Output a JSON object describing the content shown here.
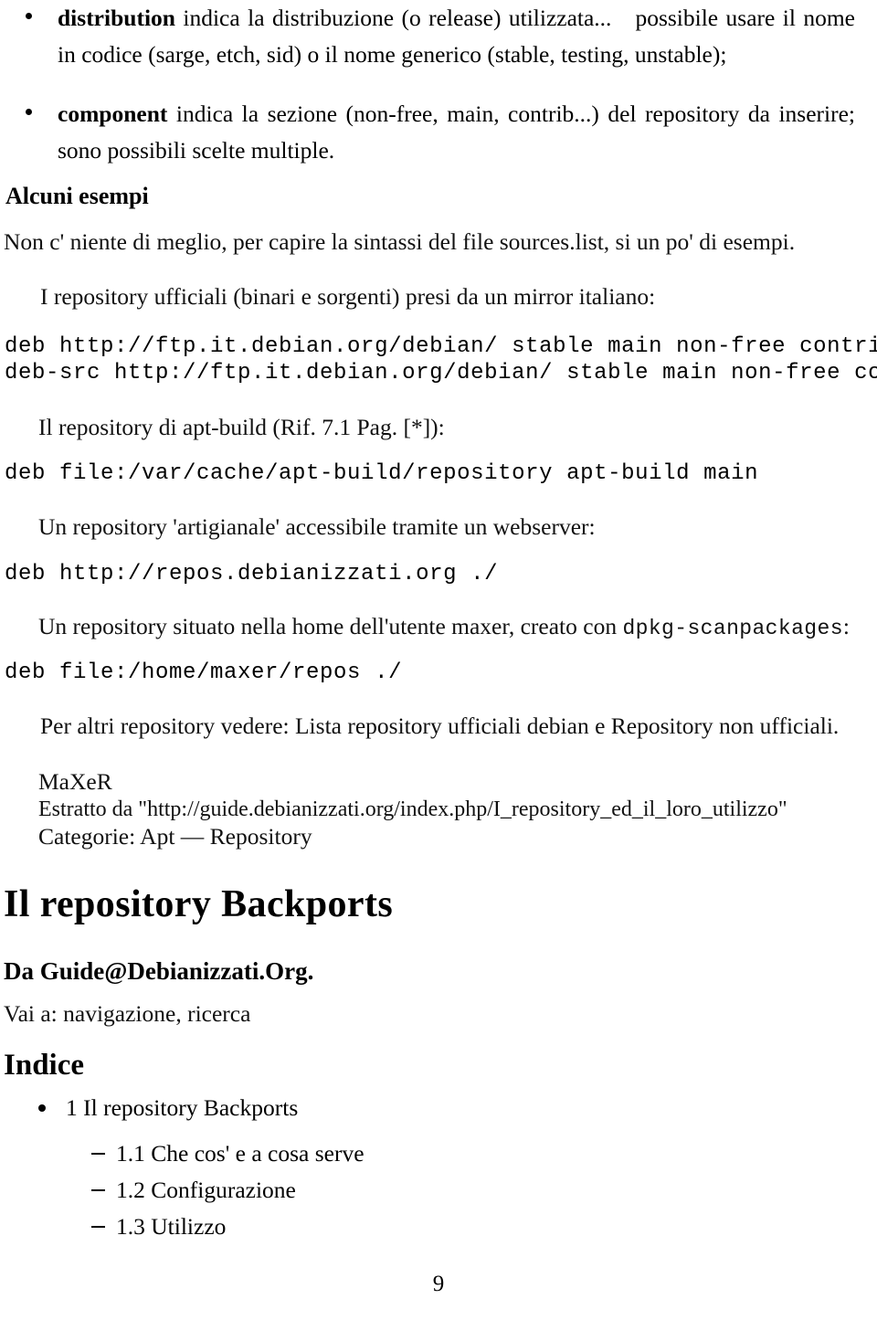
{
  "document": {
    "language": "it",
    "page_number": "9",
    "colors": {
      "text": "#111111",
      "background": "#ffffff"
    }
  },
  "bullets": [
    {
      "term": "distribution",
      "text_before_gap": " indica la distribuzione (o release) utilizzata...",
      "text_after_gap": "possibile usare il nome in codice (sarge, etch, sid) o il nome generico (stable, testing, unstable);"
    },
    {
      "term": "component",
      "text_before_gap": " indica la sezione (non-free, main, contrib...) del repository da inserire; sono possibili scelte multiple.",
      "text_after_gap": ""
    }
  ],
  "section_examples": {
    "heading": "Alcuni esempi",
    "intro_paragraph": "Non c' niente di meglio, per capire la sintassi del file sources.list, si un po' di esempi.",
    "caption_official": "I repository ufficiali (binari e sorgenti) presi da un mirror italiano:",
    "code_official": [
      "deb http://ftp.it.debian.org/debian/ stable main non-free contrib",
      "deb-src http://ftp.it.debian.org/debian/ stable main non-free contrib"
    ],
    "caption_aptbuild": "Il repository di apt-build (Rif. 7.1 Pag. [*]):",
    "code_aptbuild": "deb file:/var/cache/apt-build/repository apt-build main",
    "caption_webserver": "Un repository 'artigianale' accessibile tramite un webserver:",
    "code_webserver": "deb http://repos.debianizzati.org ./",
    "caption_home_prefix": "Un repository situato nella home dell'utente maxer, creato con ",
    "caption_home_mono": "dpkg-scanpackages",
    "caption_home_suffix": ":",
    "code_home": "deb file:/home/maxer/repos ./",
    "see_also": "Per altri repository vedere: Lista repository ufficiali debian e Repository non ufficiali.",
    "author": "MaXeR",
    "source_line": "Estratto da \"http://guide.debianizzati.org/index.php/I_repository_ed_il_loro_utilizzo\"",
    "categories_line": "Categorie: Apt — Repository"
  },
  "section_backports": {
    "title": "Il repository Backports",
    "source": "Da Guide@Debianizzati.Org.",
    "navigation": "Vai a: navigazione, ricerca",
    "toc_heading": "Indice",
    "toc": [
      {
        "level": 1,
        "label": "1 Il repository Backports"
      },
      {
        "level": 2,
        "label": "1.1 Che cos' e a cosa serve"
      },
      {
        "level": 2,
        "label": "1.2 Configurazione"
      },
      {
        "level": 2,
        "label": "1.3 Utilizzo"
      }
    ]
  }
}
